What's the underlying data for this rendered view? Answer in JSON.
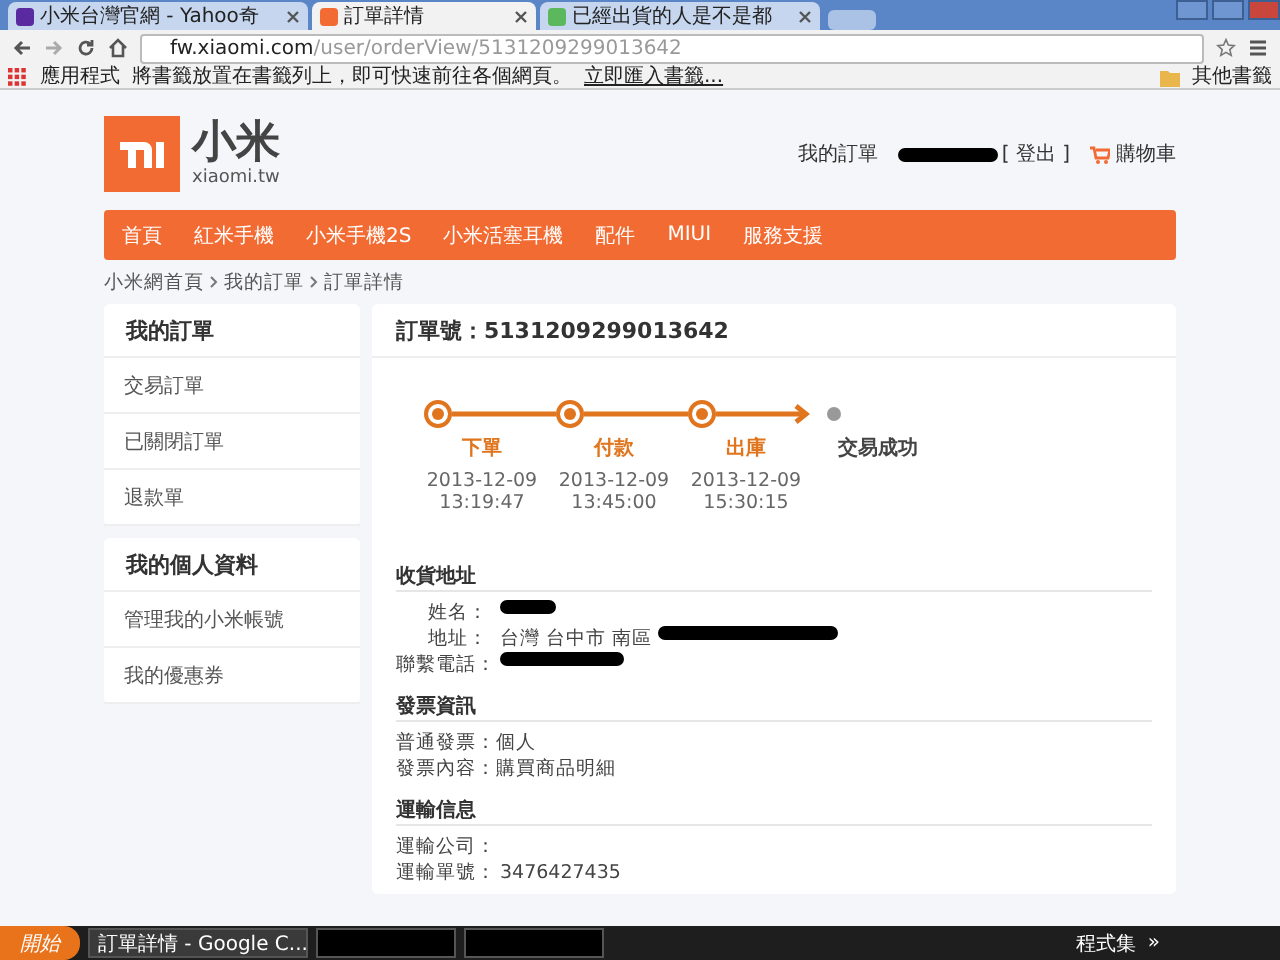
{
  "browser": {
    "tabs": [
      {
        "title": "小米台灣官網 - Yahoo奇",
        "selected": false
      },
      {
        "title": "訂單詳情",
        "selected": true
      },
      {
        "title": "已經出貨的人是不是都",
        "selected": false
      }
    ],
    "url_host": "fw.xiaomi.com",
    "url_path": "/user/orderView/5131209299013642",
    "bookmarks": [
      {
        "kind": "apps",
        "label": "應用程式"
      },
      {
        "kind": "hint",
        "label": "將書籤放置在書籤列上，即可快速前往各個網頁。"
      },
      {
        "kind": "link",
        "label": "立即匯入書籤..."
      }
    ],
    "other_bookmarks": "其他書籤"
  },
  "header": {
    "logo_text": "小米",
    "logo_domain": "xiaomi.tw",
    "links": [
      {
        "kind": "text",
        "label": "我的訂單"
      },
      {
        "kind": "user",
        "label": "[ 登出 ]"
      },
      {
        "kind": "cart",
        "label": "購物車"
      }
    ]
  },
  "nav": [
    "首頁",
    "紅米手機",
    "小米手機2S",
    "小米活塞耳機",
    "配件",
    "MIUI",
    "服務支援"
  ],
  "breadcrumb": [
    "小米網首頁",
    "我的訂單",
    "訂單詳情"
  ],
  "sidebar": [
    {
      "title": "我的訂單",
      "items": [
        "交易訂單",
        "已關閉訂單",
        "退款單"
      ]
    },
    {
      "title": "我的個人資料",
      "items": [
        "管理我的小米帳號",
        "我的優惠券"
      ]
    }
  ],
  "order": {
    "number": "訂單號：5131209299013642",
    "steps": [
      {
        "label": "下單",
        "date": "2013-12-09",
        "time": "13:19:47",
        "done": true
      },
      {
        "label": "付款",
        "date": "2013-12-09",
        "time": "13:45:00",
        "done": true
      },
      {
        "label": "出庫",
        "date": "2013-12-09",
        "time": "15:30:15",
        "done": true
      },
      {
        "label": "交易成功",
        "done": false
      }
    ],
    "sections": [
      {
        "title": "收貨地址",
        "kind": "aligned",
        "rows": [
          {
            "label": "姓名：",
            "redacted": true
          },
          {
            "label": "地址：",
            "value": "台灣 台中市 南區",
            "redacted": true
          },
          {
            "label": "聯繫電話：",
            "redacted": true
          }
        ]
      },
      {
        "title": "發票資訊",
        "kind": "inline",
        "rows": [
          {
            "label": "普通發票：",
            "value": "個人",
            "redacted": false
          },
          {
            "label": "發票內容：",
            "value": "購買商品明細",
            "redacted": false
          }
        ]
      },
      {
        "title": "運輸信息",
        "kind": "aligned",
        "rows": [
          {
            "label": "運輸公司：",
            "redacted": false
          },
          {
            "label": "運輸單號：",
            "value": "3476427435",
            "redacted": false
          }
        ]
      }
    ]
  },
  "taskbar": {
    "start": "開始",
    "tasks": [
      {
        "label": "訂單詳情 - Google C...",
        "redacted": false
      },
      {
        "redacted": true
      },
      {
        "redacted": true
      }
    ],
    "tray_label": "程式集",
    "tray_more": "»"
  }
}
